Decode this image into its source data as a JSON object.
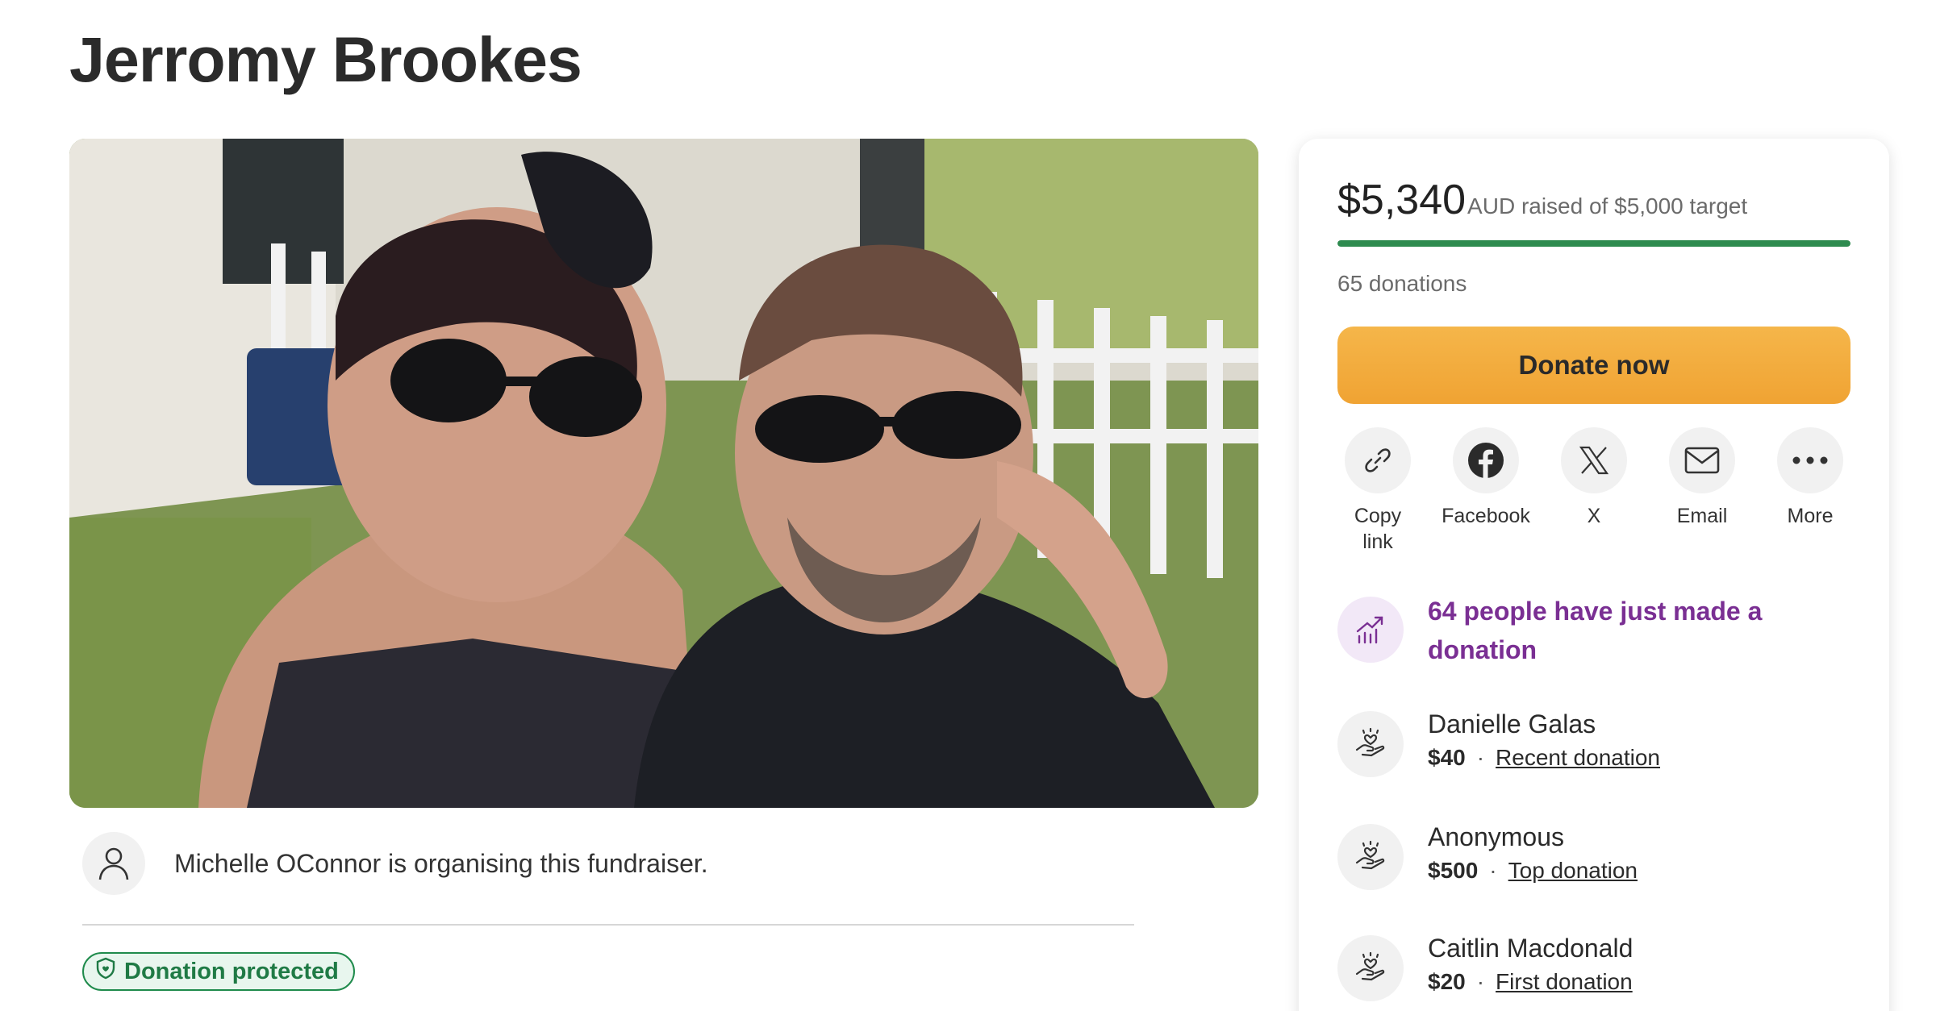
{
  "page": {
    "title": "Jerromy Brookes"
  },
  "organiser": {
    "text": "Michelle OConnor is organising this fundraiser."
  },
  "badge": {
    "label": "Donation protected"
  },
  "fundraiser": {
    "raised": "$5,340",
    "raised_suffix": "AUD raised of $5,000 target",
    "progress_fraction": 1.0,
    "donations": "65 donations",
    "donate_label": "Donate now"
  },
  "share": [
    {
      "label": "Copy link",
      "icon": "link-icon"
    },
    {
      "label": "Facebook",
      "icon": "facebook-icon"
    },
    {
      "label": "X",
      "icon": "x-icon"
    },
    {
      "label": "Email",
      "icon": "email-icon"
    },
    {
      "label": "More",
      "icon": "more-icon"
    }
  ],
  "activity": {
    "text": "64 people have just made a donation",
    "icon": "trending-up-icon"
  },
  "donors": [
    {
      "name": "Danielle Galas",
      "amount": "$40",
      "tag": "Recent donation"
    },
    {
      "name": "Anonymous",
      "amount": "$500",
      "tag": "Top donation"
    },
    {
      "name": "Caitlin Macdonald",
      "amount": "$20",
      "tag": "First donation"
    }
  ],
  "colors": {
    "accent_green": "#2e8b4f",
    "donate_orange": "#f0a333",
    "activity_purple": "#7a2f93",
    "badge_green": "#1f7a45"
  }
}
